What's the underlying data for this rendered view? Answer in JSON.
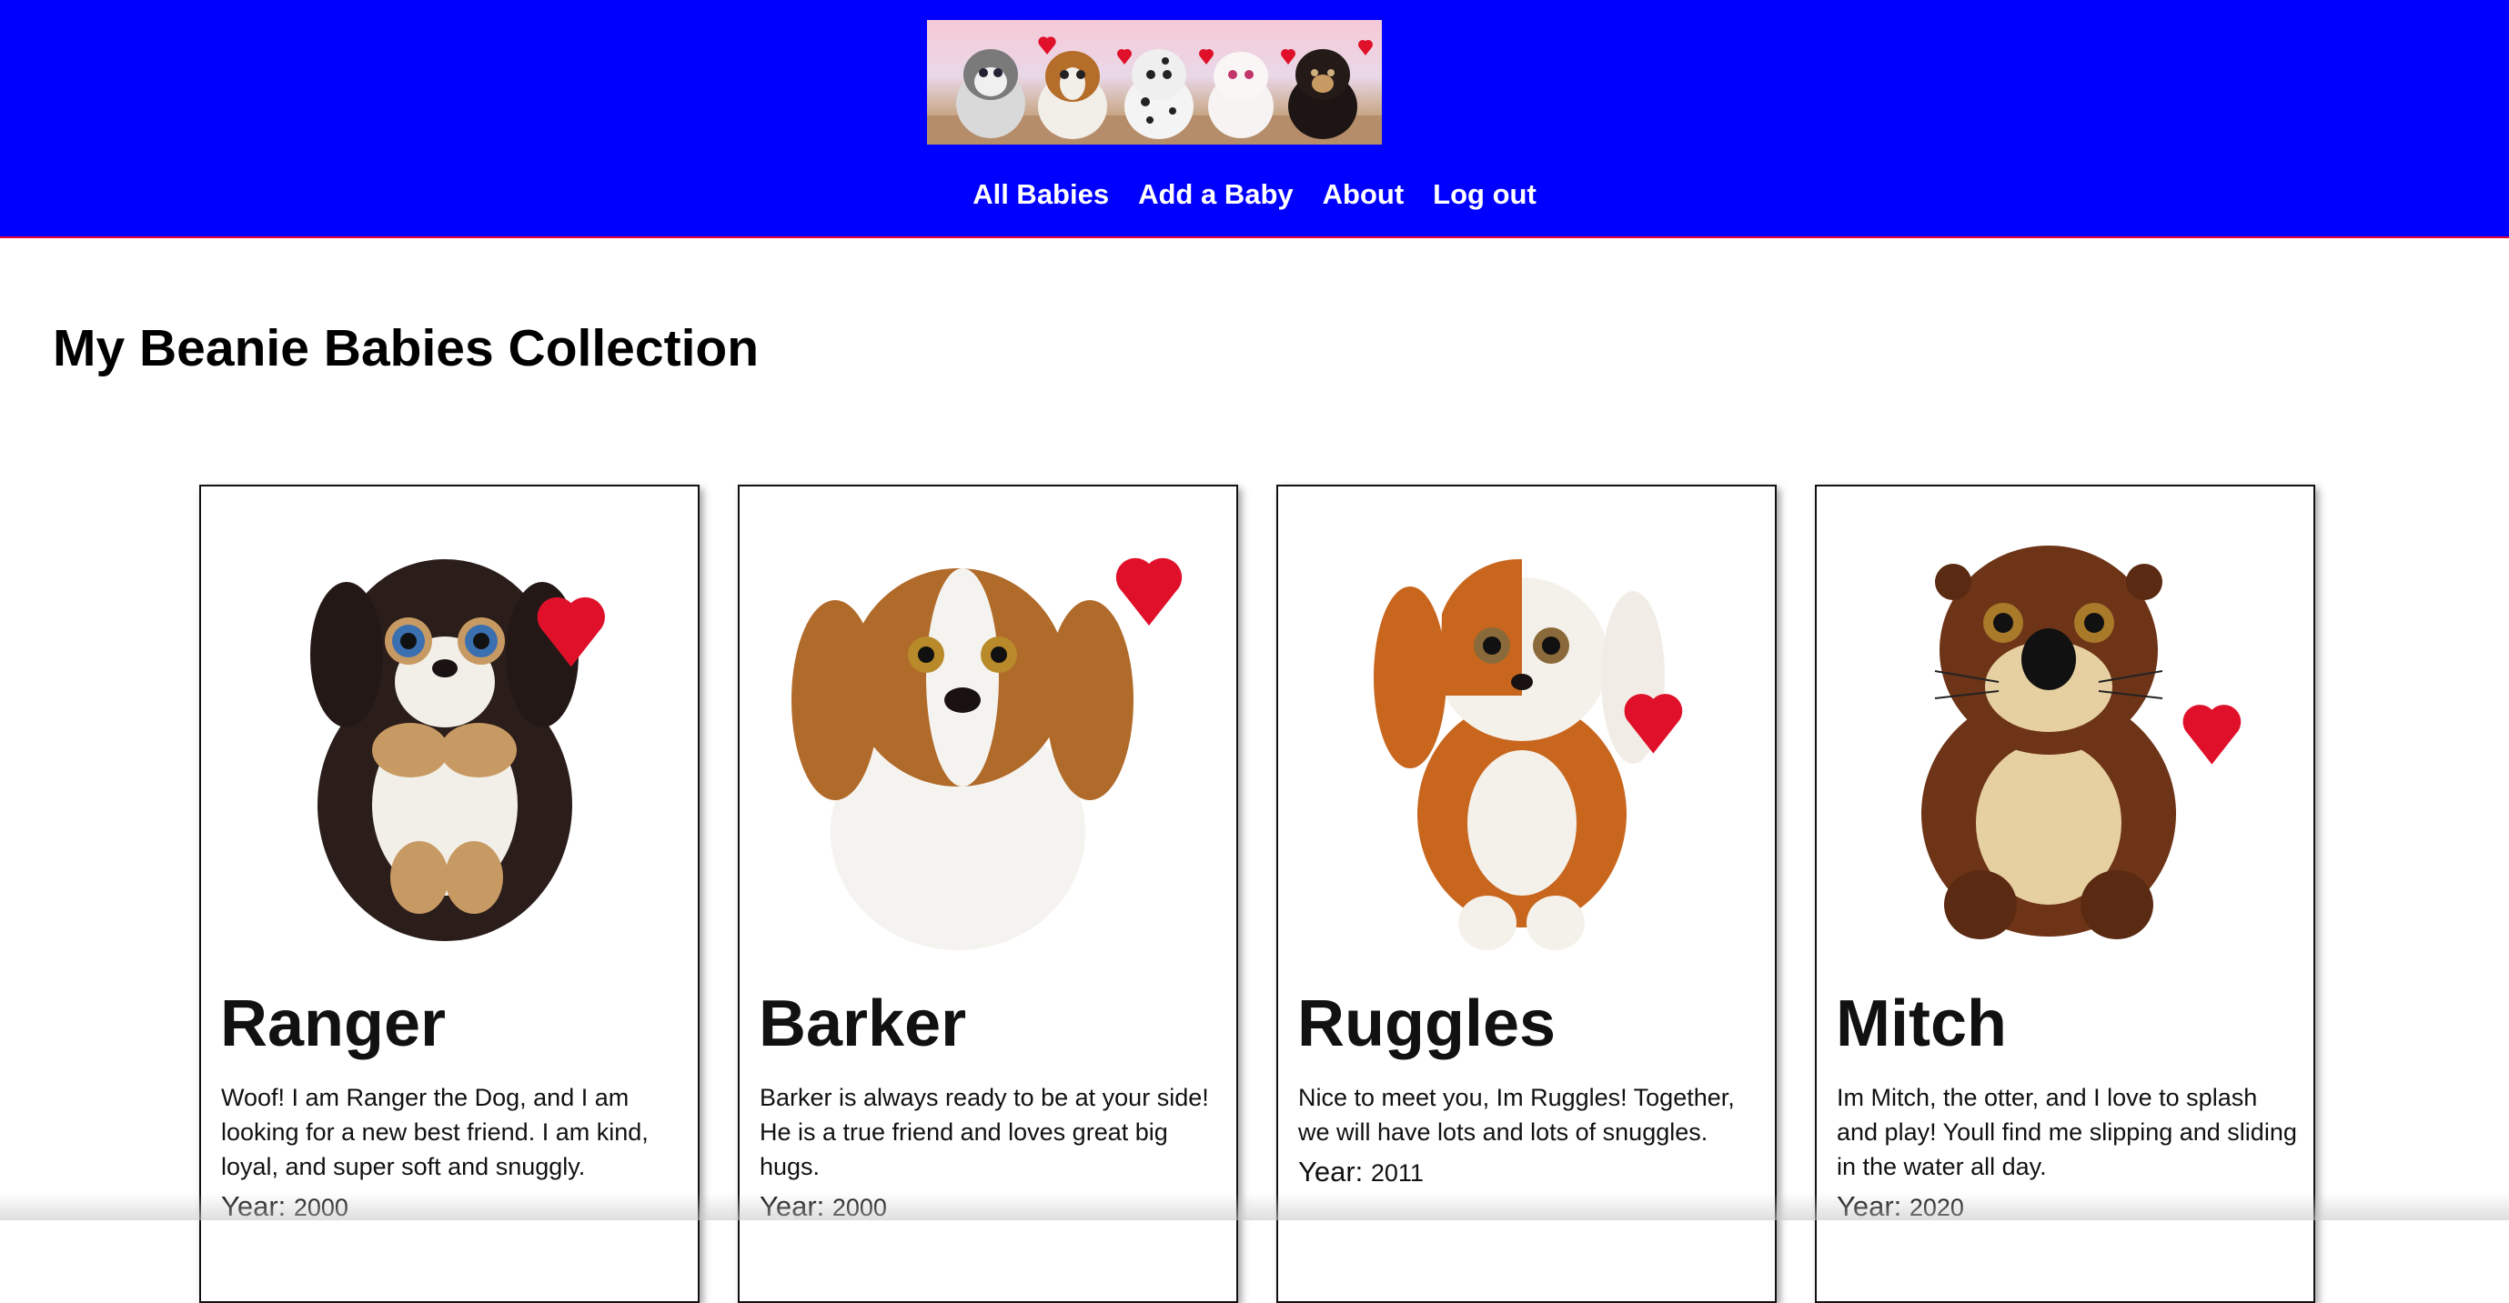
{
  "header": {
    "background_color": "#0000fe",
    "banner_alt": "Ty Beanie Babies banner",
    "nav": [
      {
        "label": "All Babies"
      },
      {
        "label": "Add a Baby"
      },
      {
        "label": "About"
      },
      {
        "label": "Log out"
      }
    ]
  },
  "main": {
    "title": "My Beanie Babies Collection",
    "year_label": "Year:",
    "cards": [
      {
        "name": "Ranger",
        "description": "Woof! I am Ranger the Dog, and I am looking for a new best friend. I am kind, loyal, and super soft and snuggly.",
        "year": "2000",
        "colors": {
          "body": "#2a1d1a",
          "accent": "#c89a63",
          "belly": "#f2efe8",
          "eye": "#3a6fb0"
        }
      },
      {
        "name": "Barker",
        "description": "Barker is always ready to be at your side! He is a true friend and loves great big hugs.",
        "year": "2000",
        "colors": {
          "body": "#b06a2a",
          "accent": "#f5f3ef",
          "belly": "#f5f3ef",
          "eye": "#b88a2a"
        }
      },
      {
        "name": "Ruggles",
        "description": "Nice to meet you, Im Ruggles! Together, we will have lots and lots of snuggles.",
        "year": "2011",
        "colors": {
          "body": "#c8661e",
          "accent": "#f4f1ea",
          "belly": "#f4f1ea",
          "eye": "#8a6a3a"
        }
      },
      {
        "name": "Mitch",
        "description": "Im Mitch, the otter, and I love to splash and play! Youll find me slipping and sliding in the water all day.",
        "year": "2020",
        "colors": {
          "body": "#6e3417",
          "accent": "#e6cfa0",
          "belly": "#e6cfa0",
          "eye": "#a87a2a"
        }
      }
    ]
  }
}
